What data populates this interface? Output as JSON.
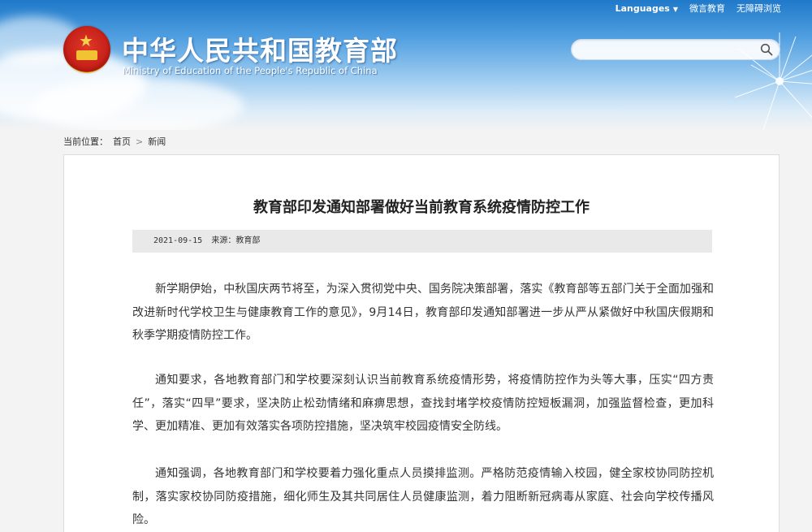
{
  "header": {
    "site_title": "中华人民共和国教育部",
    "site_subtitle": "Ministry of Education of the People's Republic of China",
    "links": {
      "languages": "Languages",
      "weiyan": "微言教育",
      "accessibility": "无障碍浏览"
    },
    "search": {
      "value": "",
      "placeholder": ""
    }
  },
  "breadcrumb": {
    "prefix": "当前位置：",
    "home": "首页",
    "separator": ">",
    "current": "新闻"
  },
  "article": {
    "title": "教育部印发通知部署做好当前教育系统疫情防控工作",
    "date": "2021-09-15",
    "source": "来源：教育部",
    "paragraphs": [
      "新学期伊始，中秋国庆两节将至，为深入贯彻党中央、国务院决策部署，落实《教育部等五部门关于全面加强和改进新时代学校卫生与健康教育工作的意见》，9月14日，教育部印发通知部署进一步从严从紧做好中秋国庆假期和秋季学期疫情防控工作。",
      "通知要求，各地教育部门和学校要深刻认识当前教育系统疫情形势，将疫情防控作为头等大事，压实“四方责任”，落实“四早”要求，坚决防止松劲情绪和麻痹思想，查找封堵学校疫情防控短板漏洞，加强监督检查，更加科学、更加精准、更加有效落实各项防控措施，坚决筑牢校园疫情安全防线。",
      "通知强调，各地教育部门和学校要着力强化重点人员摸排监测。严格防范疫情输入校园，健全家校协同防控机制，落实家校协同防疫措施，细化师生及其共同居住人员健康监测，着力阻断新冠病毒从家庭、社会向学校传播风险。"
    ]
  },
  "icons": {
    "emblem": "national-emblem-icon",
    "search": "search-icon",
    "caret": "caret-down-icon"
  },
  "colors": {
    "header_blue": "#1f79c9",
    "text": "#333333",
    "meta_bg": "#e9e9e9"
  }
}
